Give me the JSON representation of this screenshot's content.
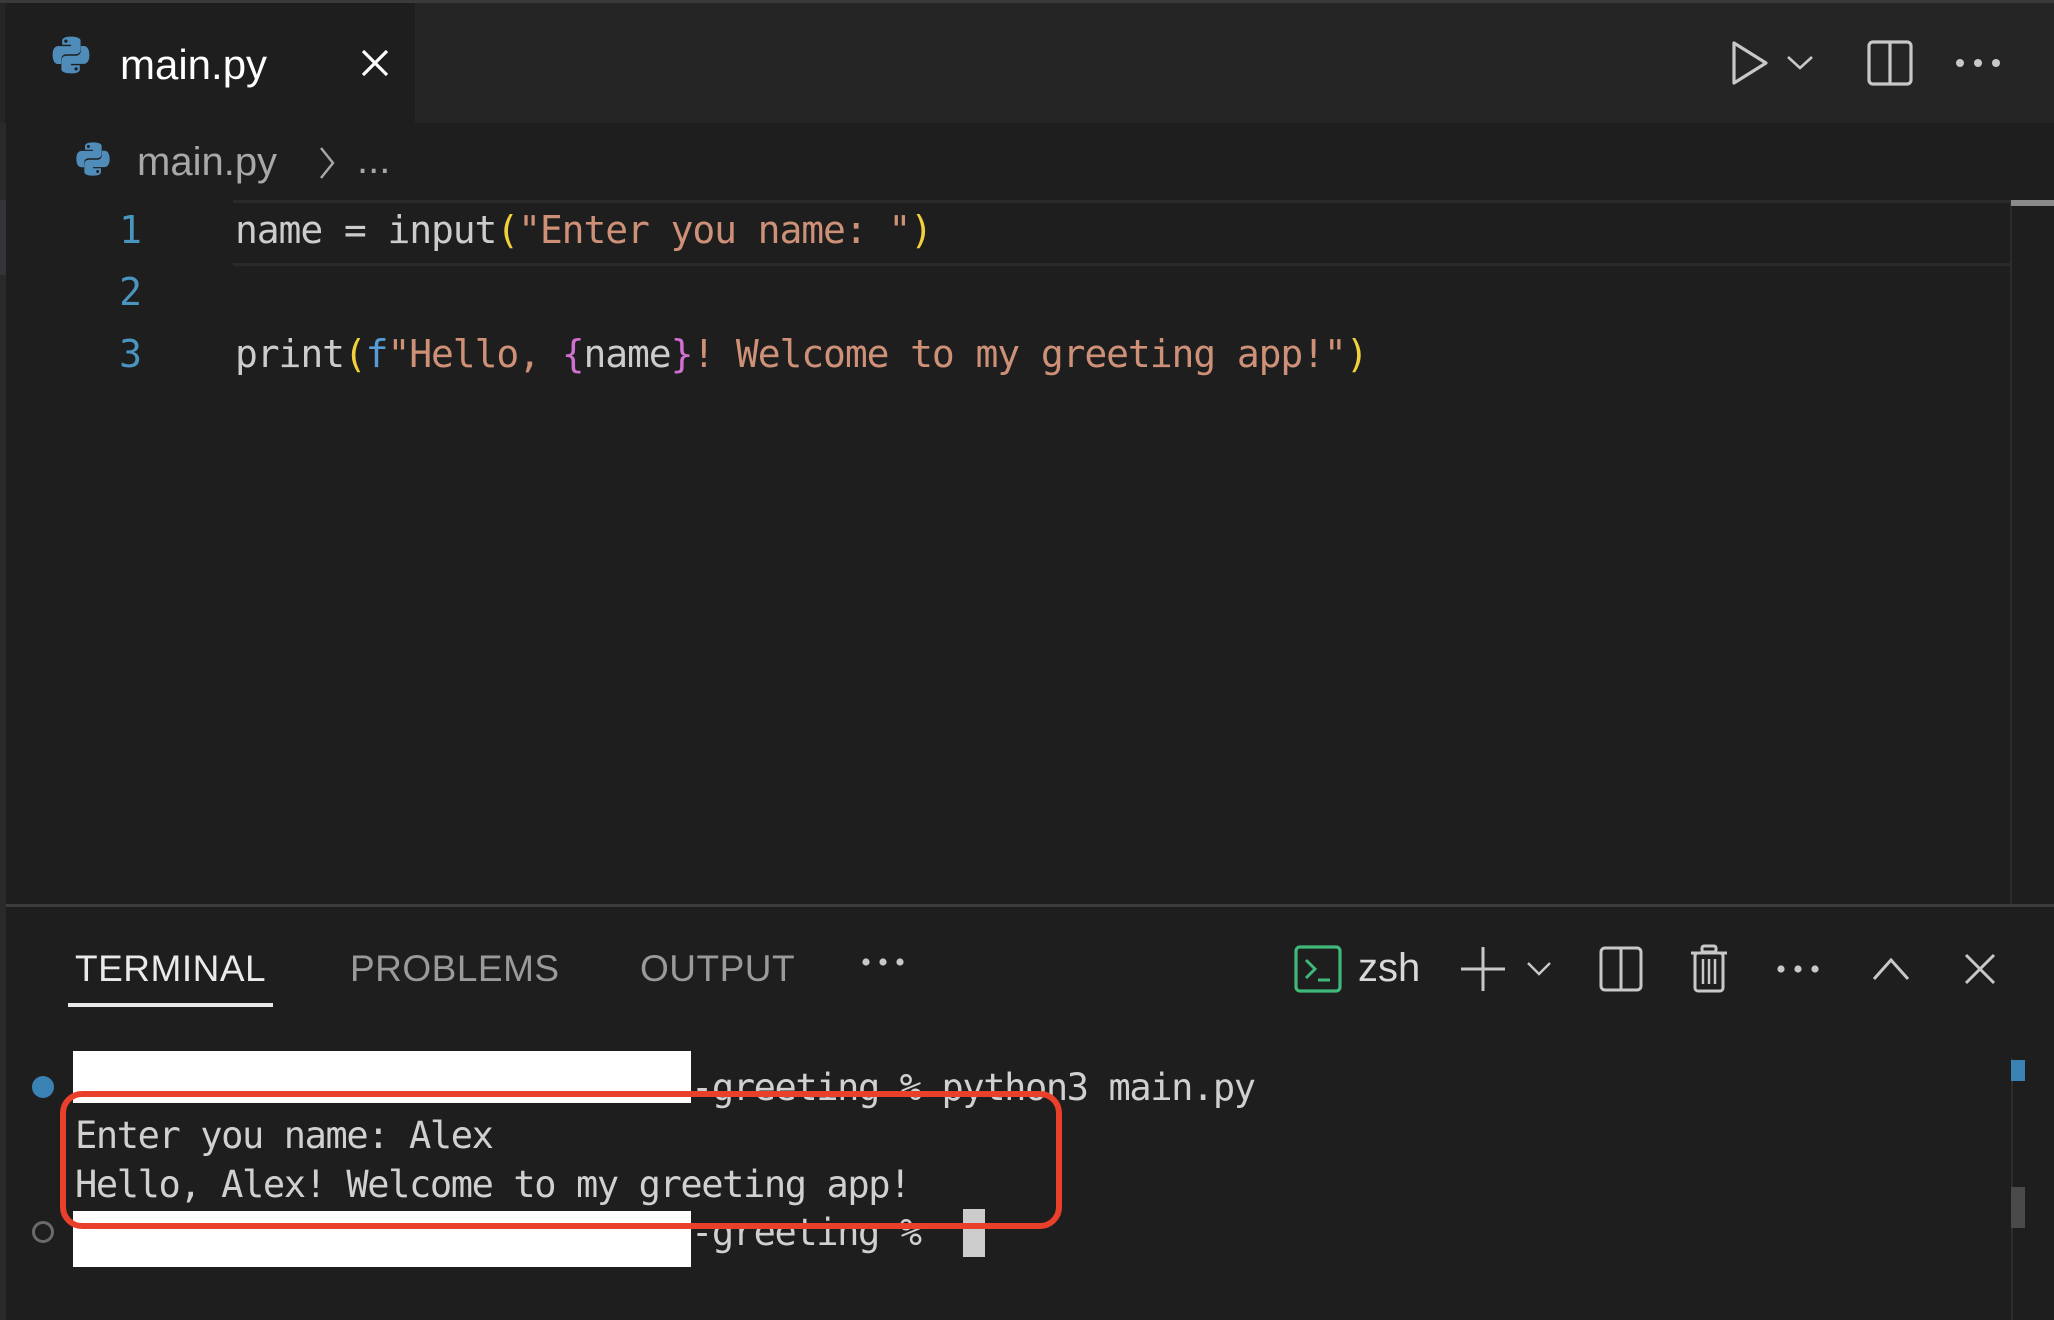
{
  "editor": {
    "tab": {
      "label": "main.py",
      "icon": "python-icon",
      "close_icon": "close-icon"
    },
    "toolbar": {
      "run": "run-icon",
      "run_dropdown": "chevron-down-icon",
      "split": "split-editor-icon",
      "more": "more-actions-icon"
    },
    "breadcrumb": {
      "file": "main.py",
      "separator": "chevron-right-icon",
      "more": "..."
    },
    "lines": [
      {
        "number": "1",
        "tokens": [
          {
            "text": "name = input",
            "kind": "plain"
          },
          {
            "text": "(",
            "kind": "paren"
          },
          {
            "text": "\"Enter you name: \"",
            "kind": "string"
          },
          {
            "text": ")",
            "kind": "paren"
          }
        ]
      },
      {
        "number": "2",
        "tokens": []
      },
      {
        "number": "3",
        "tokens": [
          {
            "text": "print",
            "kind": "plain"
          },
          {
            "text": "(",
            "kind": "paren"
          },
          {
            "text": "f",
            "kind": "keyword"
          },
          {
            "text": "\"Hello, ",
            "kind": "string"
          },
          {
            "text": "{",
            "kind": "brace"
          },
          {
            "text": "name",
            "kind": "plain"
          },
          {
            "text": "}",
            "kind": "brace"
          },
          {
            "text": "! Welcome to my greeting app!\"",
            "kind": "string"
          },
          {
            "text": ")",
            "kind": "paren"
          }
        ]
      }
    ],
    "colors": {
      "plain": "#cccccc",
      "paren": "#f2cf3c",
      "string": "#ce9178",
      "keyword": "#569cd6",
      "brace": "#d070d0",
      "line_number": "#4a95c0"
    }
  },
  "panel": {
    "tabs": [
      {
        "label": "TERMINAL",
        "active": true
      },
      {
        "label": "PROBLEMS",
        "active": false
      },
      {
        "label": "OUTPUT",
        "active": false
      }
    ],
    "more_tabs": "···",
    "terminal_name": "zsh",
    "actions": {
      "terminal": "terminal-icon",
      "new": "plus-icon",
      "new_dropdown": "chevron-down-icon",
      "split": "split-terminal-icon",
      "kill": "trash-icon",
      "more": "more-actions-icon",
      "maximize": "chevron-up-icon",
      "close": "close-icon"
    }
  },
  "terminal": {
    "lines": [
      {
        "text": "-greeting % python3 main.py",
        "redacted_prefix": true,
        "status": "success"
      },
      {
        "text": "Enter you name: Alex",
        "redacted_prefix": false
      },
      {
        "text": "Hello, Alex! Welcome to my greeting app!",
        "redacted_prefix": false
      },
      {
        "text": "-greeting % ",
        "redacted_prefix": true,
        "status": "idle"
      }
    ],
    "highlight_color": "#e8402a",
    "status_color": "#3b82b4"
  }
}
